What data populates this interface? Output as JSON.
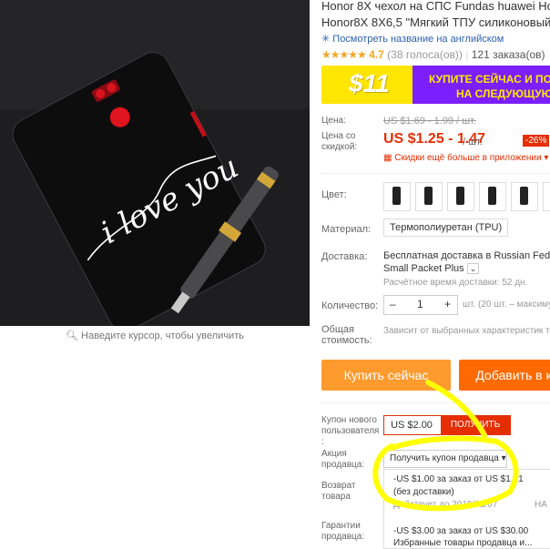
{
  "product": {
    "title_line1": "Honor 8X чехол на СПС Fundas huawei Honor",
    "title_line2": "Honor8X 8X6,5 \"Мягкий ТПУ силиконовый те",
    "translate_link": "Посмотреть название на английском",
    "rating_value": "4.7",
    "votes": "(38 голоса(ов))",
    "orders": "121 заказа(ов)",
    "case_text": "i love you",
    "zoom_hint": "Наведите курсор, чтобы увеличить"
  },
  "banner": {
    "big": "$11",
    "line1": "КУПИТЕ СЕЙЧАС И ПОЛУ",
    "line2": "НА СЛЕДУЮЩУЮ П"
  },
  "price": {
    "label": "Цена:",
    "old": "US $1.69 - 1.99 / шт.",
    "discount_label": "Цена со скидкой:",
    "current": "US $1.25 - 1.47",
    "unit": "/ шт.",
    "discount": "-26%",
    "app_discount": "Скидки ещё больше в приложении"
  },
  "color": {
    "label": "Цвет:"
  },
  "material": {
    "label": "Материал:",
    "value": "Термополиуретан (TPU)"
  },
  "shipping": {
    "label": "Доставка:",
    "line1": "Бесплатная доставка в Russian Federa",
    "line2": "Small Packet Plus",
    "time": "Расчётное время доставки: 52 дн."
  },
  "quantity": {
    "label": "Количество:",
    "value": "1",
    "info": "шт. (20 шт. – максиму",
    "minus": "–",
    "plus": "+"
  },
  "total": {
    "label": "Общая стоимость:",
    "value": "Зависит от выбранных характеристик то"
  },
  "buttons": {
    "buy_now": "Купить сейчас",
    "add_to_cart": "Добавить в к"
  },
  "coupons": {
    "new_user_label": "Купон нового пользователя :",
    "new_user_value": "US $2.00",
    "get_label": "ПОЛУЧИТЬ",
    "seller_label": "Акция продавца:",
    "seller_button": "Получить купон продавца",
    "return_label": "Возврат товара",
    "guarantee_label": "Гарантии продавца:",
    "offer1_line1": "-US $1.00 за заказ от US $1.01",
    "offer1_line2": "(без доставки)",
    "offer1_valid": "Действует до 2019/03/07",
    "offer1_extra": "НА",
    "offer2_line1": "-US $3.00 за заказ от US $30.00",
    "offer2_line2": "Избранные товары продавца и..."
  },
  "colors": {
    "accent": "#e62e04",
    "buy": "#ff9a2e",
    "cart": "#ff6a00",
    "highlight": "#ffff00"
  }
}
